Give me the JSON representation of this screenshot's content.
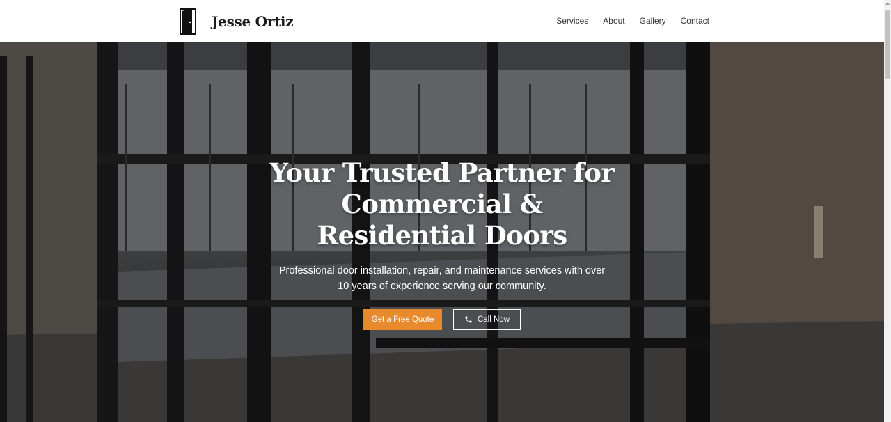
{
  "header": {
    "brand_name": "Jesse Ortiz",
    "brand_icon": "door-icon",
    "nav": [
      {
        "label": "Services"
      },
      {
        "label": "About"
      },
      {
        "label": "Gallery"
      },
      {
        "label": "Contact"
      }
    ]
  },
  "hero": {
    "title": "Your Trusted Partner for Commercial & Residential Doors",
    "subtitle": "Professional door installation, repair, and maintenance services with over 10 years of experience serving our community.",
    "primary_button": "Get a Free Quote",
    "secondary_button": "Call Now",
    "secondary_icon": "phone-icon"
  },
  "colors": {
    "accent": "#e8892b",
    "header_bg": "#ffffff",
    "text_dark": "#1a1a1a"
  }
}
